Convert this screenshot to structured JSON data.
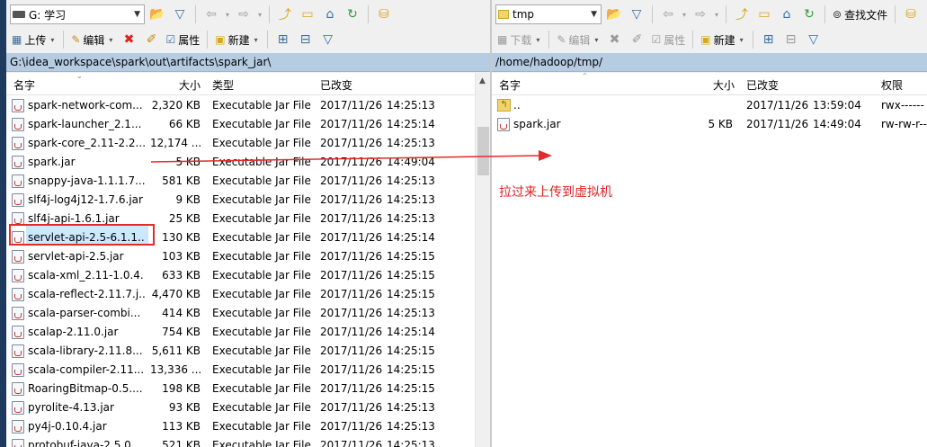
{
  "left": {
    "drive": "G: 学习",
    "toolbar": {
      "upload": "上传",
      "edit": "编辑",
      "properties": "属性",
      "new": "新建"
    },
    "path": "G:\\idea_workspace\\spark\\out\\artifacts\\spark_jar\\",
    "columns": {
      "name": "名字",
      "size": "大小",
      "type": "类型",
      "changed": "已改变"
    },
    "files": [
      {
        "name": "spark-network-com...",
        "size": "2,320 KB",
        "type": "Executable Jar File",
        "date": "2017/11/26",
        "time": "14:25:13"
      },
      {
        "name": "spark-launcher_2.1...",
        "size": "66 KB",
        "type": "Executable Jar File",
        "date": "2017/11/26",
        "time": "14:25:14"
      },
      {
        "name": "spark-core_2.11-2.2...",
        "size": "12,174 ...",
        "type": "Executable Jar File",
        "date": "2017/11/26",
        "time": "14:25:13"
      },
      {
        "name": "spark.jar",
        "size": "5 KB",
        "type": "Executable Jar File",
        "date": "2017/11/26",
        "time": "14:49:04"
      },
      {
        "name": "snappy-java-1.1.1.7...",
        "size": "581 KB",
        "type": "Executable Jar File",
        "date": "2017/11/26",
        "time": "14:25:13"
      },
      {
        "name": "slf4j-log4j12-1.7.6.jar",
        "size": "9 KB",
        "type": "Executable Jar File",
        "date": "2017/11/26",
        "time": "14:25:13"
      },
      {
        "name": "slf4j-api-1.6.1.jar",
        "size": "25 KB",
        "type": "Executable Jar File",
        "date": "2017/11/26",
        "time": "14:25:13"
      },
      {
        "name": "servlet-api-2.5-6.1.1...",
        "size": "130 KB",
        "type": "Executable Jar File",
        "date": "2017/11/26",
        "time": "14:25:14"
      },
      {
        "name": "servlet-api-2.5.jar",
        "size": "103 KB",
        "type": "Executable Jar File",
        "date": "2017/11/26",
        "time": "14:25:15"
      },
      {
        "name": "scala-xml_2.11-1.0.4...",
        "size": "633 KB",
        "type": "Executable Jar File",
        "date": "2017/11/26",
        "time": "14:25:15"
      },
      {
        "name": "scala-reflect-2.11.7.j...",
        "size": "4,470 KB",
        "type": "Executable Jar File",
        "date": "2017/11/26",
        "time": "14:25:15"
      },
      {
        "name": "scala-parser-combi...",
        "size": "414 KB",
        "type": "Executable Jar File",
        "date": "2017/11/26",
        "time": "14:25:13"
      },
      {
        "name": "scalap-2.11.0.jar",
        "size": "754 KB",
        "type": "Executable Jar File",
        "date": "2017/11/26",
        "time": "14:25:14"
      },
      {
        "name": "scala-library-2.11.8...",
        "size": "5,611 KB",
        "type": "Executable Jar File",
        "date": "2017/11/26",
        "time": "14:25:15"
      },
      {
        "name": "scala-compiler-2.11...",
        "size": "13,336 ...",
        "type": "Executable Jar File",
        "date": "2017/11/26",
        "time": "14:25:15"
      },
      {
        "name": "RoaringBitmap-0.5....",
        "size": "198 KB",
        "type": "Executable Jar File",
        "date": "2017/11/26",
        "time": "14:25:15"
      },
      {
        "name": "pyrolite-4.13.jar",
        "size": "93 KB",
        "type": "Executable Jar File",
        "date": "2017/11/26",
        "time": "14:25:13"
      },
      {
        "name": "py4j-0.10.4.jar",
        "size": "113 KB",
        "type": "Executable Jar File",
        "date": "2017/11/26",
        "time": "14:25:13"
      },
      {
        "name": "protobuf-java-2.5.0...",
        "size": "521 KB",
        "type": "Executable Jar File",
        "date": "2017/11/26",
        "time": "14:25:13"
      }
    ]
  },
  "right": {
    "drive": "tmp",
    "toolbar": {
      "download": "下载",
      "edit": "编辑",
      "properties": "属性",
      "new": "新建",
      "find_files": "查找文件"
    },
    "path": "/home/hadoop/tmp/",
    "columns": {
      "name": "名字",
      "size": "大小",
      "changed": "已改变",
      "perms": "权限"
    },
    "files": [
      {
        "name": "..",
        "size": "",
        "date": "2017/11/26",
        "time": "13:59:04",
        "perms": "rwx------"
      },
      {
        "name": "spark.jar",
        "size": "5 KB",
        "date": "2017/11/26",
        "time": "14:49:04",
        "perms": "rw-rw-r--"
      }
    ]
  },
  "annotation": "拉过来上传到虚拟机",
  "colors": {
    "accent": "#e32b2b",
    "path_bar": "#b6cce3",
    "selection": "#cce8ff"
  }
}
